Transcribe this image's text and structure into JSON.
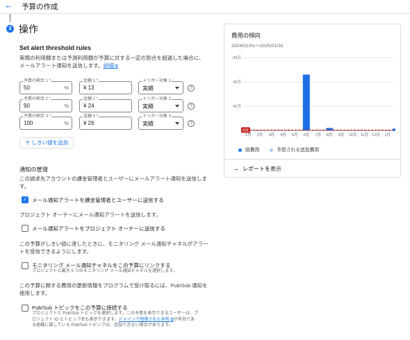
{
  "header": {
    "title": "予算の作成",
    "back_icon": "arrow-left-icon"
  },
  "step": {
    "number": "3",
    "title": "操作"
  },
  "threshold": {
    "title": "Set alert threshold rules",
    "description": "実際の利用額または予測利用額が予算に対する一定の割合を超過した場合に、メールアラート通知を送信します。",
    "details_link": "詳細",
    "rules": [
      {
        "percent_label": "予算の割合 1 *",
        "percent": "50",
        "amount_label": "金額 1 *",
        "amount": "¥ 13",
        "trigger_label": "トリガー対象 1",
        "trigger": "実績"
      },
      {
        "percent_label": "予算の割合 2 *",
        "percent": "90",
        "amount_label": "金額 2 *",
        "amount": "¥ 24",
        "trigger_label": "トリガー対象 2",
        "trigger": "実績"
      },
      {
        "percent_label": "予算の割合 3 *",
        "percent": "100",
        "amount_label": "金額 3 *",
        "amount": "¥ 26",
        "trigger_label": "トリガー対象 3",
        "trigger": "実績"
      }
    ],
    "percent_suffix": "%",
    "add_button": "十 しきい値を追加"
  },
  "notifications": {
    "title": "通知の管理",
    "intro": "この請求先アカウントの課金管理者とユーザーにメールアラート通知を送信します。",
    "email_admins_label": "メール通知アラートを課金管理者とユーザーに送信する",
    "email_admins_checked": true,
    "owners_text": "プロジェクト オーナーにメール通知アラートを送信します。",
    "email_owners_label": "メール通知アラートをプロジェクト オーナーに送信する",
    "email_owners_checked": false,
    "monitoring_text": "この予算がしきい値に達したときに、モニタリング メール通知チャネルがアラートを受信できるようにします。",
    "monitoring_label": "モニタリング メール通知チャネルをこの予算にリンクする",
    "monitoring_sub": "プロジェクトと最大 5 つのモニタリング メール通知チャネルを選択します。",
    "monitoring_checked": false,
    "pubsub_text": "この予算に関する費用の更新情報をプログラムで受け取るには、Pub/Sub 通知を使用します。",
    "pubsub_label": "Pub/Sub トピックをこの予算に接続する",
    "pubsub_sub_1": "プロジェクトと Pub/Sub トピックを選択します。この予算を表示できるユーザーは、プロジェクト ID とトピック名も表示できます。",
    "pubsub_sub_link": "ドメインで制限された共有",
    "pubsub_sub_2": "が有効である組織に属している Pub/Sub トピックは、追加できない場合があります。",
    "pubsub_checked": false
  },
  "cost_card": {
    "title": "費用の傾向",
    "range": "2024/01/01〜2025/01/31",
    "report_link": "レポートを表示",
    "legend": [
      {
        "label": "総費用",
        "color": "#1a73e8"
      },
      {
        "label": "予想される追加費用",
        "color": "#aecbfa"
      }
    ],
    "budget_marker": "¥25",
    "colors": {
      "bar": "#1e6ee6",
      "budget_line": "#c5221f",
      "grid": "#e8eaed",
      "axis": "#80868b"
    }
  },
  "chart_data": {
    "type": "bar",
    "categories": [
      "1月",
      "2月",
      "3月",
      "4月",
      "5月",
      "6月",
      "7月",
      "8月",
      "9月",
      "10月",
      "11月",
      "12月",
      "1月"
    ],
    "series": [
      {
        "name": "総費用",
        "values": [
          0,
          0,
          0,
          0,
          0,
          23000,
          0,
          1000,
          0,
          0,
          0,
          0,
          0
        ]
      }
    ],
    "yticks": [
      "¥3万",
      "¥2万",
      "¥1万"
    ],
    "ytick_values": [
      30000,
      20000,
      10000
    ],
    "ylim": [
      0,
      30000
    ],
    "budget_line": 25,
    "grid": true,
    "legend": "bottom"
  }
}
